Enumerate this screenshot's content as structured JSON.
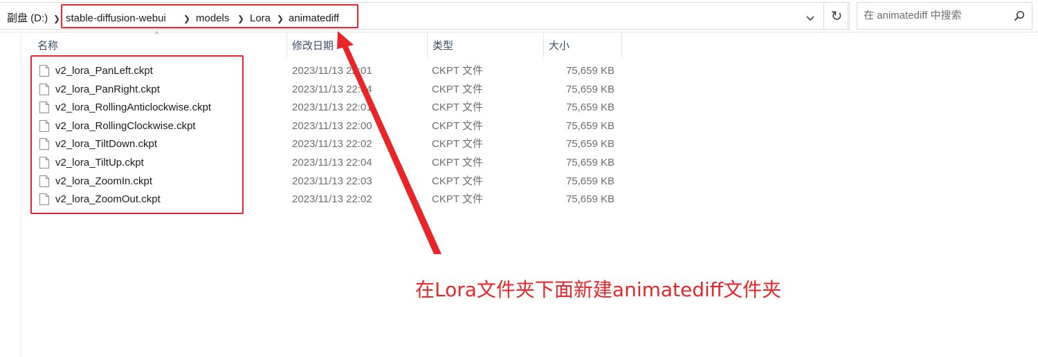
{
  "address_bar": {
    "drive": "副盘 (D:)",
    "crumbs": [
      "stable-diffusion-webui",
      "models",
      "Lora",
      "animatediff"
    ]
  },
  "search": {
    "placeholder": "在 animatediff 中搜索"
  },
  "columns": {
    "name": "名称",
    "date": "修改日期",
    "type": "类型",
    "size": "大小"
  },
  "files": [
    {
      "name": "v2_lora_PanLeft.ckpt",
      "date": "2023/11/13 22:01",
      "type": "CKPT 文件",
      "size": "75,659 KB"
    },
    {
      "name": "v2_lora_PanRight.ckpt",
      "date": "2023/11/13 22:04",
      "type": "CKPT 文件",
      "size": "75,659 KB"
    },
    {
      "name": "v2_lora_RollingAnticlockwise.ckpt",
      "date": "2023/11/13 22:01",
      "type": "CKPT 文件",
      "size": "75,659 KB"
    },
    {
      "name": "v2_lora_RollingClockwise.ckpt",
      "date": "2023/11/13 22:00",
      "type": "CKPT 文件",
      "size": "75,659 KB"
    },
    {
      "name": "v2_lora_TiltDown.ckpt",
      "date": "2023/11/13 22:02",
      "type": "CKPT 文件",
      "size": "75,659 KB"
    },
    {
      "name": "v2_lora_TiltUp.ckpt",
      "date": "2023/11/13 22:04",
      "type": "CKPT 文件",
      "size": "75,659 KB"
    },
    {
      "name": "v2_lora_ZoomIn.ckpt",
      "date": "2023/11/13 22:03",
      "type": "CKPT 文件",
      "size": "75,659 KB"
    },
    {
      "name": "v2_lora_ZoomOut.ckpt",
      "date": "2023/11/13 22:02",
      "type": "CKPT 文件",
      "size": "75,659 KB"
    }
  ],
  "annotation": {
    "text": "在Lora文件夹下面新建animatediff文件夹",
    "color": "#e8262a"
  },
  "icons": {
    "breadcrumb_separator": "chevron-right-icon",
    "dropdown": "chevron-down-icon",
    "refresh": "refresh-icon",
    "search": "search-icon",
    "file": "file-icon",
    "sort": "sort-up-icon"
  }
}
